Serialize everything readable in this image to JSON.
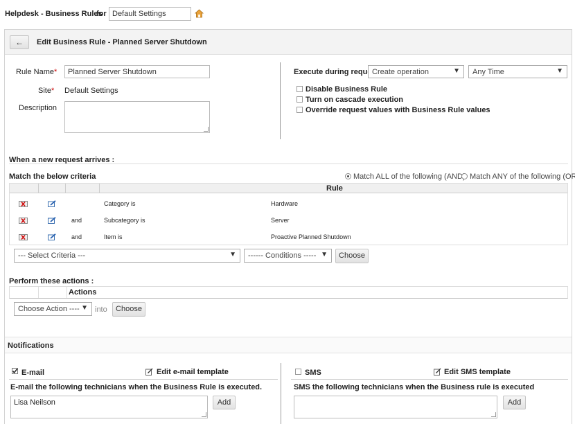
{
  "header": {
    "title": "Helpdesk - Business Rules",
    "for_label": "for",
    "site_select": "Default Settings"
  },
  "toolbar": {
    "back_label": "←",
    "title": "Edit Business Rule - Planned Server Shutdown"
  },
  "form": {
    "rule_name_label": "Rule Name",
    "rule_name_value": "Planned Server Shutdown",
    "site_label": "Site",
    "site_value": "Default Settings",
    "description_label": "Description",
    "description_value": "",
    "required_mark": "*",
    "execute_label": "Execute during request",
    "execute_operation": "Create operation",
    "execute_time": "Any Time",
    "options": [
      {
        "label": "Disable Business Rule",
        "checked": false
      },
      {
        "label": "Turn on cascade execution",
        "checked": false
      },
      {
        "label": "Override request values with Business Rule values",
        "checked": false
      }
    ]
  },
  "criteria": {
    "arrives_heading": "When a new request arrives :",
    "match_heading": "Match the below criteria",
    "match_all": "Match ALL of the following (AND)",
    "match_any": "Match ANY of the following (OR)",
    "rule_header": "Rule",
    "rows": [
      {
        "conj": "",
        "field": "Category is",
        "value": "Hardware"
      },
      {
        "conj": "and",
        "field": "Subcategory is",
        "value": "Server"
      },
      {
        "conj": "and",
        "field": "Item is",
        "value": "Proactive Planned Shutdown"
      }
    ],
    "select_criteria": "--- Select Criteria ---",
    "conditions": "------ Conditions -----",
    "choose_label": "Choose"
  },
  "actions": {
    "heading": "Perform these actions :",
    "header": "Actions",
    "choose_action": "Choose Action ----",
    "into_label": "into",
    "choose_label": "Choose"
  },
  "notifications": {
    "heading": "Notifications",
    "email": {
      "label": "E-mail",
      "checked": true,
      "edit_template": "Edit e-mail template",
      "description": "E-mail the following technicians when the Business Rule is executed.",
      "value": "Lisa Neilson",
      "add_label": "Add"
    },
    "sms": {
      "label": "SMS",
      "checked": false,
      "edit_template": "Edit SMS template",
      "description": "SMS the following technicians when the Business rule is executed",
      "value": "",
      "add_label": "Add"
    }
  },
  "colors": {
    "required": "#cc0000",
    "toolbar_bg": "#f3f3f3",
    "table_header_bg": "#f0f0f0"
  }
}
